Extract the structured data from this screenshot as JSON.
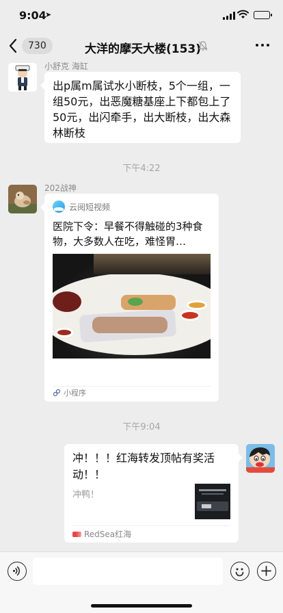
{
  "status_bar": {
    "time": "9:04"
  },
  "header": {
    "unread_count": "730",
    "title": "大洋的摩天大楼(153)"
  },
  "messages": [
    {
      "sender": "小舒克 海缸",
      "text": "出p属m属试水小断枝，5个一组，一组50元，出恶魔糖基座上下都包上了50元，出闪牵手，出大断枝，出大森林断枝"
    },
    {
      "timestamp": "下午4:22"
    },
    {
      "sender": "202战神",
      "mini_program": {
        "source": "云阅短视频",
        "title": "医院下令：早餐不得触碰的3种食物，大多数人在吃，难怪胃…",
        "footer": "小程序"
      }
    },
    {
      "timestamp": "下午9:04"
    },
    {
      "link_card": {
        "title": "冲！！！红海转发顶帖有奖活动！！",
        "description": "冲鸭！",
        "source": "RedSea红海"
      }
    }
  ],
  "input_bar": {
    "placeholder": ""
  }
}
